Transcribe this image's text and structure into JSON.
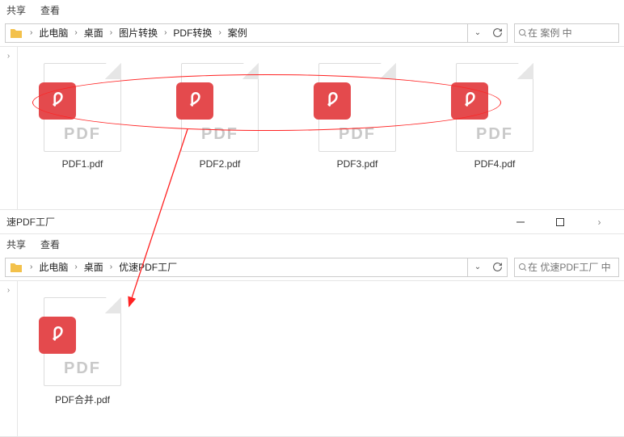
{
  "toolbar": {
    "share": "共享",
    "view": "查看"
  },
  "top": {
    "breadcrumb": [
      "此电脑",
      "桌面",
      "图片转换",
      "PDF转换",
      "案例"
    ],
    "search_placeholder": "在 案例 中",
    "files": [
      {
        "name": "PDF1.pdf"
      },
      {
        "name": "PDF2.pdf"
      },
      {
        "name": "PDF3.pdf"
      },
      {
        "name": "PDF4.pdf"
      }
    ]
  },
  "bottom": {
    "title": "速PDF工厂",
    "breadcrumb": [
      "此电脑",
      "桌面",
      "优速PDF工厂"
    ],
    "search_placeholder": "在 优速PDF工厂 中",
    "files": [
      {
        "name": "PDF合并.pdf"
      }
    ]
  }
}
